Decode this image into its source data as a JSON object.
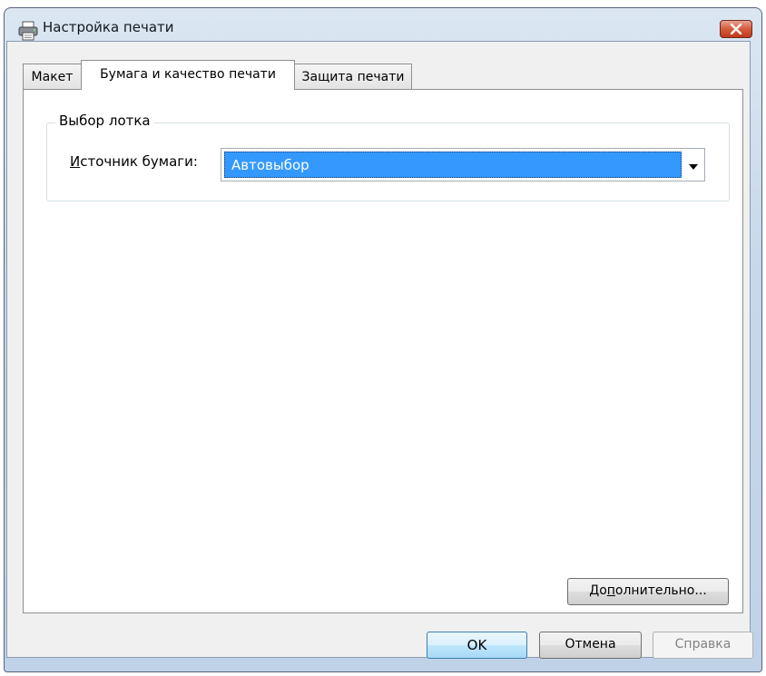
{
  "window": {
    "title": "Настройка печати",
    "icon": "printer-icon",
    "close_icon": "close-icon"
  },
  "tabs": [
    {
      "label": "Макет",
      "active": false
    },
    {
      "label": "Бумага и качество печати",
      "active": true
    },
    {
      "label": "Защита печати",
      "active": false
    }
  ],
  "tray_group": {
    "legend": "Выбор лотка",
    "source_label_mnemonic": "И",
    "source_label_rest": "сточник бумаги:",
    "source_value": "Автовыбор"
  },
  "buttons": {
    "advanced_pre": "До",
    "advanced_mnemonic": "п",
    "advanced_post": "олнительно...",
    "ok": "OK",
    "cancel": "Отмена",
    "help": "Справка"
  },
  "colors": {
    "selection": "#3399ff",
    "close_button": "#c0391b",
    "titlebar": "#c7d8ea"
  }
}
